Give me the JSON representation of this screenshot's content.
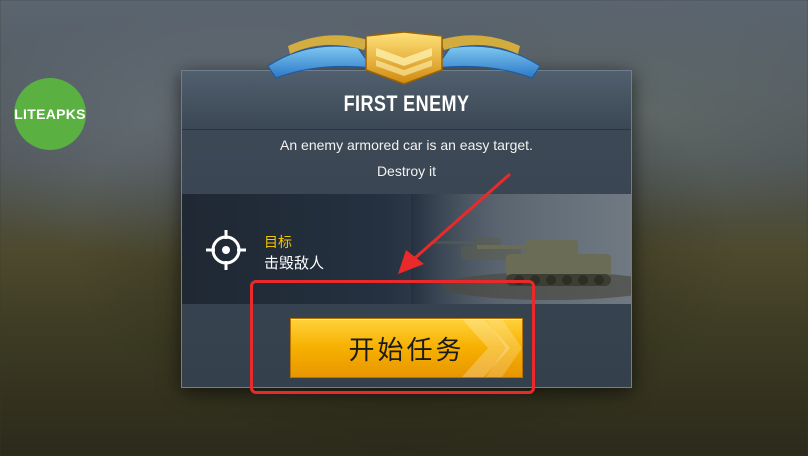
{
  "watermark": {
    "text": "LITEAPKS"
  },
  "dialog": {
    "title": "FIRST ENEMY",
    "description_line1": "An enemy armored car is an easy target.",
    "description_line2": "Destroy it",
    "objective": {
      "label": "目标",
      "text": "击毁敌人",
      "icon": "target-icon"
    },
    "start_button": {
      "label": "开始任务"
    }
  },
  "colors": {
    "accent_yellow": "#f6b000",
    "objective_label": "#f5c400",
    "highlight_red": "#ea2a2a",
    "watermark_green": "#5bb042"
  }
}
